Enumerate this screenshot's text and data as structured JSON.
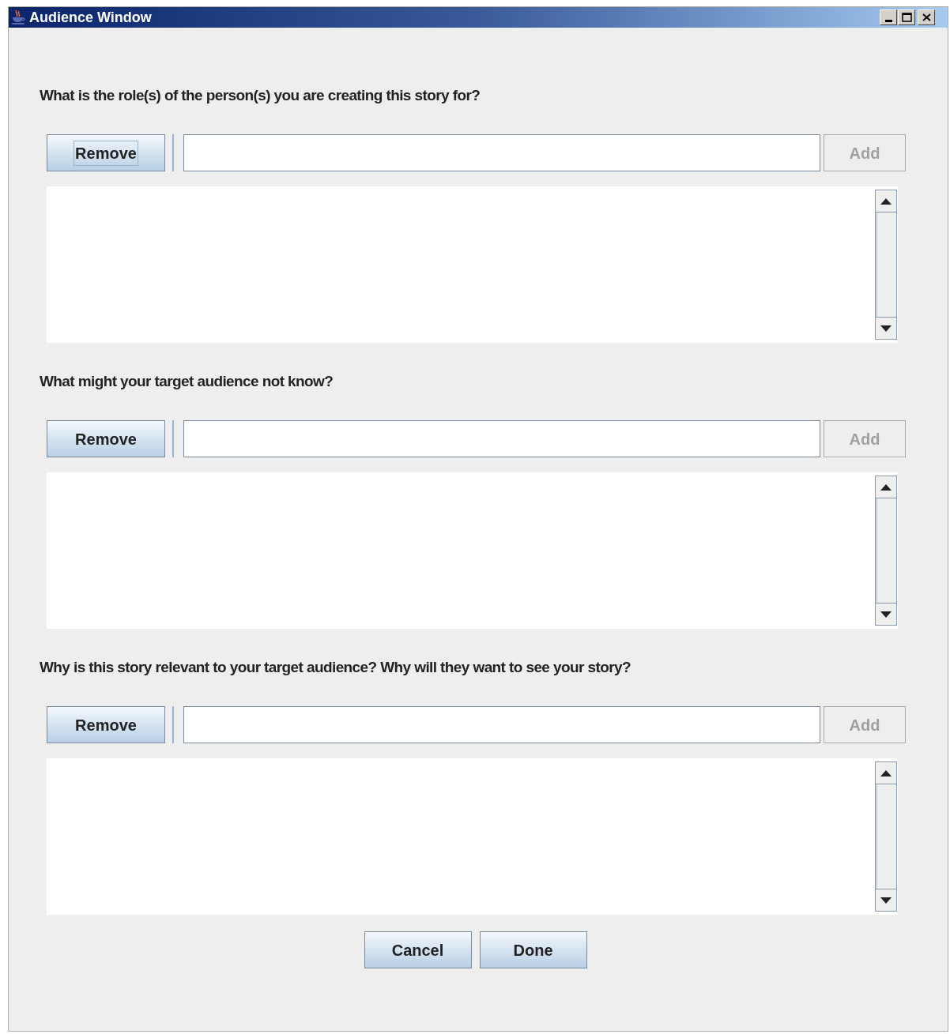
{
  "window": {
    "title": "Audience Window"
  },
  "sections": [
    {
      "question": "What is the role(s) of the person(s) you are creating this story for?",
      "remove_button": {
        "label": "Remove",
        "focused": true
      },
      "add_button": {
        "label": "Add",
        "disabled": true
      }
    },
    {
      "question": "What might your target audience not know?",
      "remove_button": {
        "label": "Remove",
        "focused": false
      },
      "add_button": {
        "label": "Add",
        "disabled": true
      }
    },
    {
      "question": "Why is this story relevant to your target audience?  Why will they want to see your story?",
      "remove_button": {
        "label": "Remove",
        "focused": false
      },
      "add_button": {
        "label": "Add",
        "disabled": true
      }
    }
  ],
  "buttons": [
    {
      "label": "Cancel"
    },
    {
      "label": "Done"
    }
  ]
}
